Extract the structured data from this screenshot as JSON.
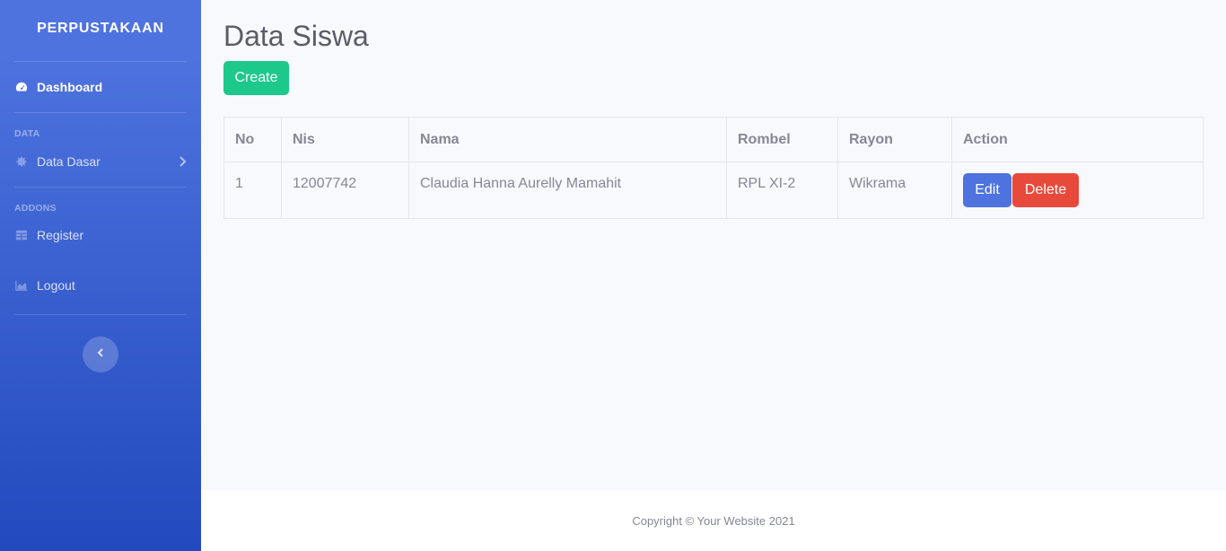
{
  "sidebar": {
    "brand": "PERPUSTAKAAN",
    "dashboard_label": "Dashboard",
    "heading_data": "DATA",
    "data_dasar_label": "Data Dasar",
    "heading_addons": "ADDONS",
    "register_label": "Register",
    "logout_label": "Logout"
  },
  "main": {
    "title": "Data Siswa",
    "create_label": "Create",
    "table": {
      "headers": [
        "No",
        "Nis",
        "Nama",
        "Rombel",
        "Rayon",
        "Action"
      ],
      "rows": [
        {
          "no": "1",
          "nis": "12007742",
          "nama": "Claudia Hanna Aurelly Mamahit",
          "rombel": "RPL XI-2",
          "rayon": "Wikrama"
        }
      ],
      "edit_label": "Edit",
      "delete_label": "Delete"
    }
  },
  "footer": {
    "copyright": "Copyright © Your Website 2021"
  },
  "icons": {
    "dashboard": "tachometer-icon",
    "data_dasar": "gear-icon",
    "register": "table-icon",
    "logout": "chart-area-icon",
    "sidebar_toggle": "chevron-left-icon"
  },
  "colors": {
    "primary": "#4e73df",
    "success": "#1cc88a",
    "danger": "#e74a3b",
    "text": "#858796"
  }
}
